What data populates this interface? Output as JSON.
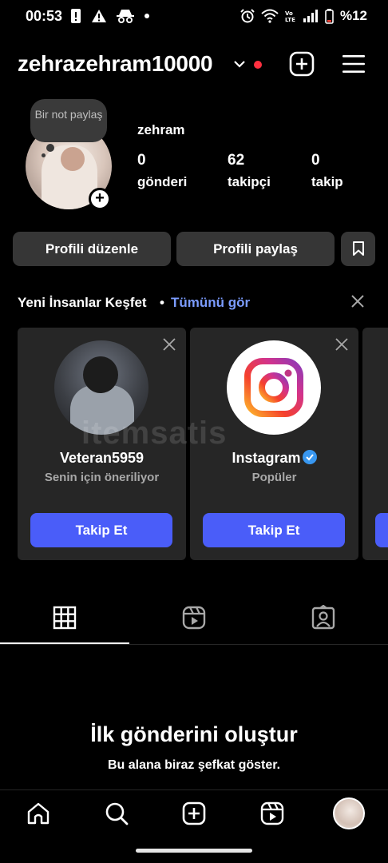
{
  "status_bar": {
    "time": "00:53",
    "battery": "%12"
  },
  "header": {
    "username": "zehrazehram10000"
  },
  "profile": {
    "note": "Bir not paylaş",
    "display_name": "zehram",
    "stats": [
      {
        "value": "0",
        "label": "gönderi"
      },
      {
        "value": "62",
        "label": "takipçi"
      },
      {
        "value": "0",
        "label": "takip"
      }
    ]
  },
  "actions": {
    "edit": "Profili düzenle",
    "share": "Profili paylaş"
  },
  "discover": {
    "title": "Yeni İnsanlar Keşfet",
    "separator": "•",
    "see_all": "Tümünü gör",
    "cards": [
      {
        "name": "Veteran5959",
        "subtitle": "Senin için öneriliyor",
        "button": "Takip Et"
      },
      {
        "name": "Instagram",
        "subtitle": "Popüler",
        "button": "Takip Et",
        "verified": true
      }
    ]
  },
  "empty_state": {
    "title": "İlk gönderini oluştur",
    "subtitle": "Bu alana biraz şefkat göster."
  },
  "watermark": "itemsatis",
  "colors": {
    "background": "#000000",
    "button": "#363636",
    "follow": "#4a5df9",
    "link": "#7b9cff",
    "notification_dot": "#ff3040"
  },
  "icons": {
    "header": [
      "chevron-down-icon",
      "add-icon",
      "menu-icon"
    ],
    "tabs": [
      "grid-icon",
      "reels-icon",
      "tagged-icon"
    ],
    "nav": [
      "home-icon",
      "search-icon",
      "create-icon",
      "reels-icon",
      "profile-avatar"
    ]
  }
}
